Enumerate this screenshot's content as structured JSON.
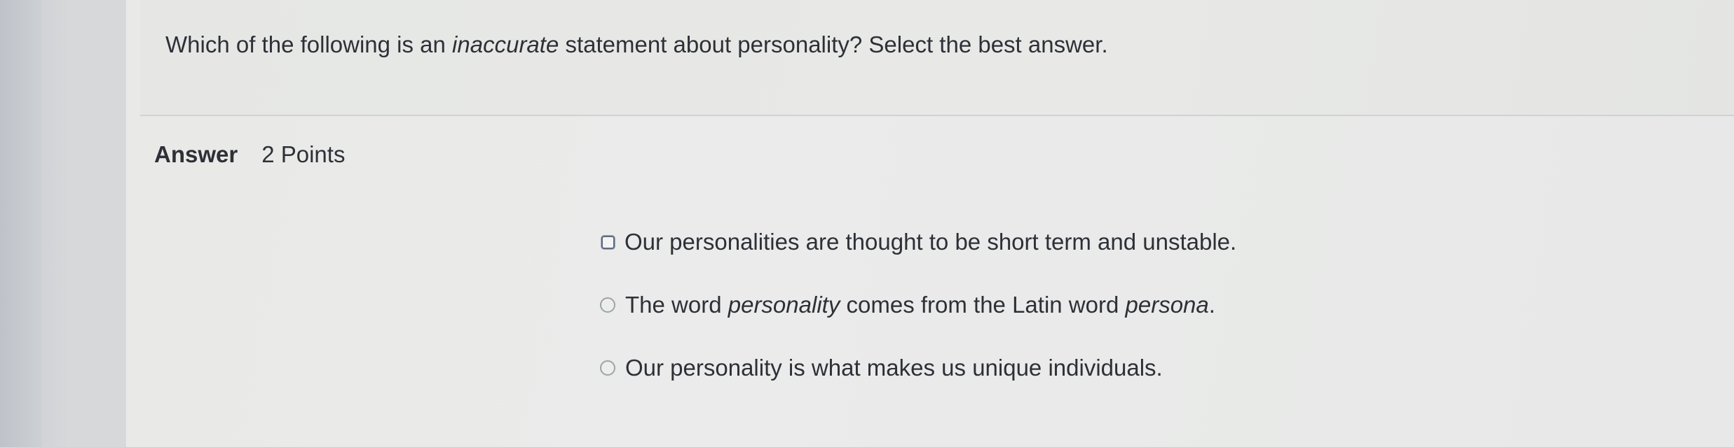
{
  "question": {
    "before": "Which of the following is an ",
    "emphasis": "inaccurate",
    "after": " statement about personality? Select the best answer."
  },
  "answer": {
    "label": "Answer",
    "points": "2 Points"
  },
  "options": [
    {
      "control": "checkbox",
      "text": "Our personalities are thought to be short term and unstable."
    },
    {
      "control": "radio",
      "part1": "The word ",
      "part2": "personality",
      "part3": " comes from the Latin word ",
      "part4": "persona",
      "part5": "."
    },
    {
      "control": "radio",
      "text": "Our personality is what makes us unique individuals."
    }
  ]
}
